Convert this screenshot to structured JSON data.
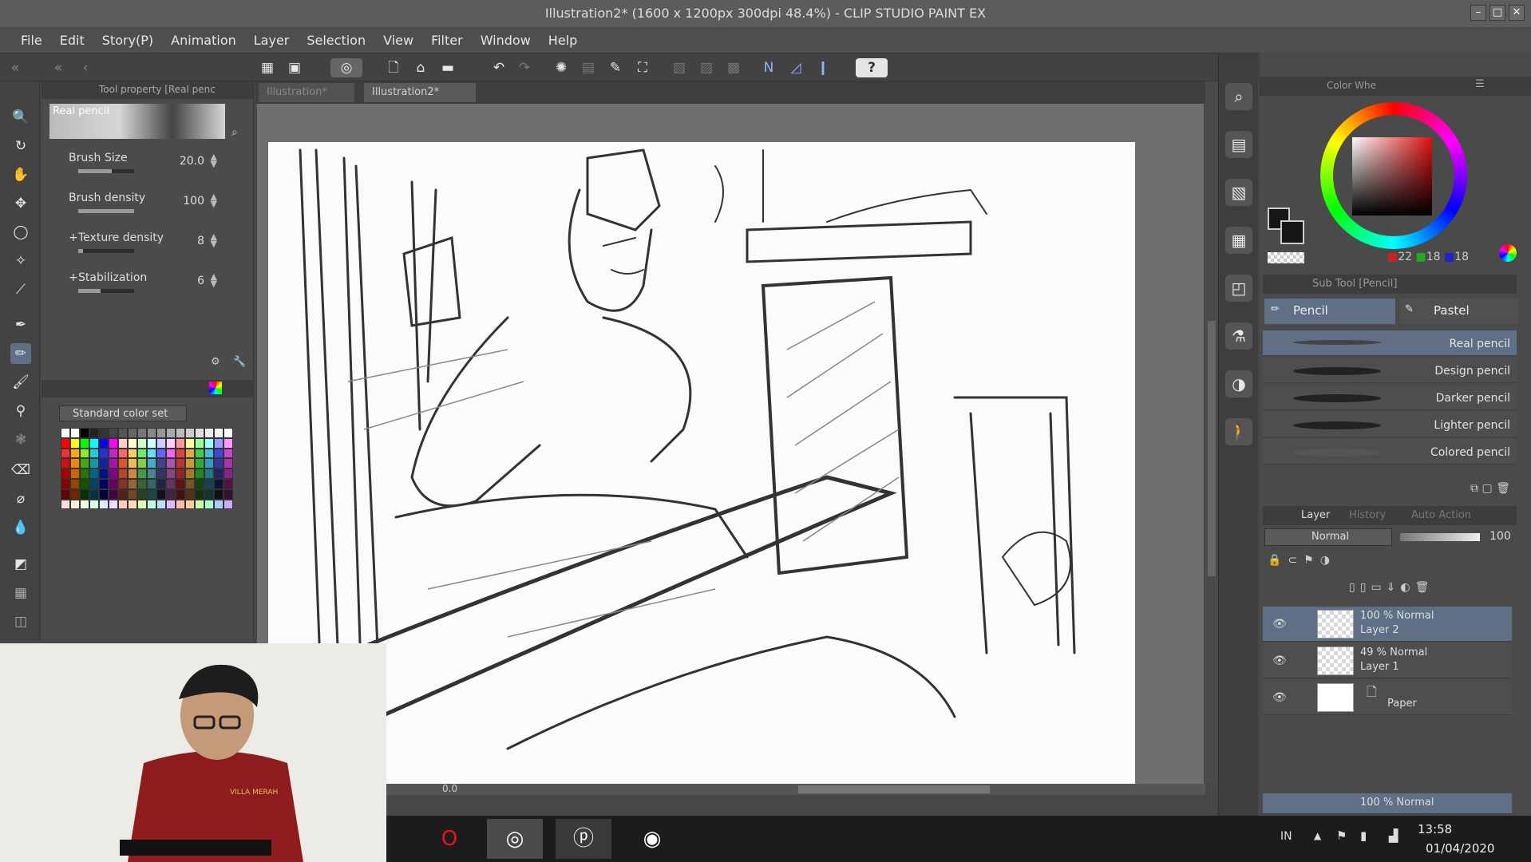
{
  "window": {
    "title": "Illustration2* (1600 x 1200px 300dpi 48.4%) - CLIP STUDIO PAINT EX"
  },
  "menu": [
    "File",
    "Edit",
    "Story(P)",
    "Animation",
    "Layer",
    "Selection",
    "View",
    "Filter",
    "Window",
    "Help"
  ],
  "toolprop": {
    "tab": "Tool property [Real penc",
    "brush_name": "Real pencil",
    "props": [
      {
        "label": "Brush Size",
        "value": "20.0",
        "fill": 0.6
      },
      {
        "label": "Brush density",
        "value": "100",
        "fill": 1.0
      },
      {
        "label": "Texture density",
        "value": "8",
        "fill": 0.08
      },
      {
        "label": "Stabilization",
        "value": "6",
        "fill": 0.4
      }
    ]
  },
  "colorset": {
    "name": "Standard color set"
  },
  "doc_tabs": [
    "Illustration*",
    "Illustration2*"
  ],
  "colorpanel": {
    "tab": "Color Whe",
    "r": "22",
    "g": "18",
    "b": "18"
  },
  "subtool": {
    "title": "Sub Tool [Pencil]",
    "groups": [
      "Pencil",
      "Pastel"
    ],
    "items": [
      "Real pencil",
      "Design pencil",
      "Darker pencil",
      "Lighter pencil",
      "Colored pencil"
    ]
  },
  "layers": {
    "tabs": [
      "Layer",
      "History",
      "Auto Action"
    ],
    "blend": "Normal",
    "opacity": "100",
    "list": [
      {
        "line1": "100 % Normal",
        "line2": "Layer 2"
      },
      {
        "line1": "49 % Normal",
        "line2": "Layer 1"
      },
      {
        "line1": "",
        "line2": "Paper"
      }
    ],
    "bottom": "100 % Normal"
  },
  "canvas_footer": {
    "zoom": "0.0"
  },
  "taskbar": {
    "lang": "IN",
    "time": "13:58",
    "date": "01/04/2020"
  },
  "webcam": {
    "shirt_text": "VILLA MERAH"
  }
}
